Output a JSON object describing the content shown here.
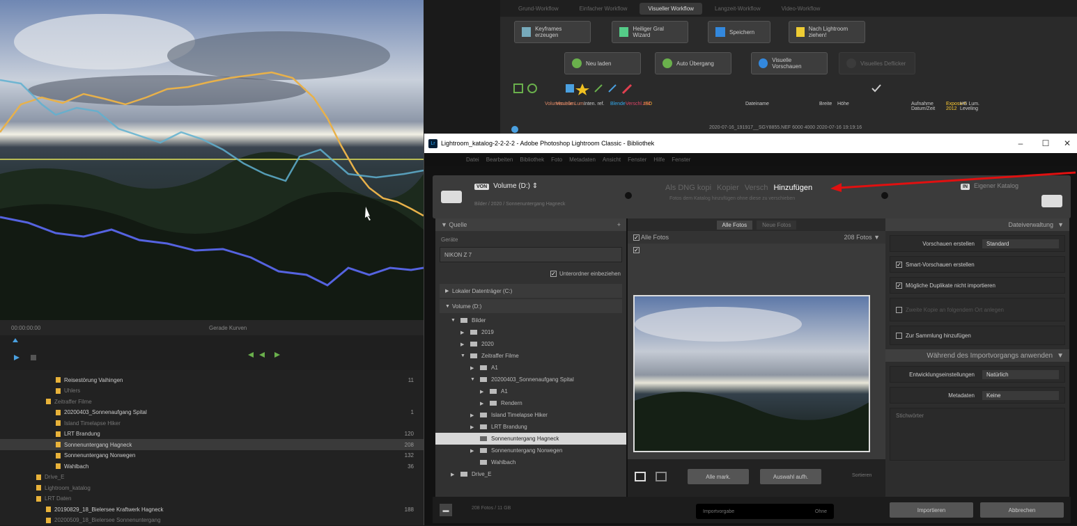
{
  "left_panel": {
    "timecode": "00:00:00:00",
    "status": "Gerade Kurven",
    "tree": [
      {
        "label": "Reisestörung Vaihingen",
        "count": "11",
        "dim": false,
        "sel": false,
        "indent": 80
      },
      {
        "label": "Uhlers",
        "count": "",
        "dim": true,
        "sel": false,
        "indent": 80
      },
      {
        "label": "Zeitraffer Filme",
        "count": "",
        "dim": true,
        "sel": false,
        "indent": 66
      },
      {
        "label": "20200403_Sonnenaufgang Spital",
        "count": "1",
        "dim": false,
        "sel": false,
        "indent": 80
      },
      {
        "label": "Island Timelapse Hiker",
        "count": "",
        "dim": true,
        "sel": false,
        "indent": 80
      },
      {
        "label": "LRT Brandung",
        "count": "120",
        "dim": false,
        "sel": false,
        "indent": 80
      },
      {
        "label": "Sonnenuntergang Hagneck",
        "count": "208",
        "dim": false,
        "sel": true,
        "indent": 80
      },
      {
        "label": "Sonnenuntergang Norwegen",
        "count": "132",
        "dim": false,
        "sel": false,
        "indent": 80
      },
      {
        "label": "Wahlbach",
        "count": "36",
        "dim": false,
        "sel": false,
        "indent": 80
      },
      {
        "label": "Drive_E",
        "count": "",
        "dim": true,
        "sel": false,
        "indent": 52
      },
      {
        "label": "Lightroom_katalog",
        "count": "",
        "dim": true,
        "sel": false,
        "indent": 52
      },
      {
        "label": "LRT Daten",
        "count": "",
        "dim": true,
        "sel": false,
        "indent": 52
      },
      {
        "label": "20190829_18_Bielersee Kraftwerk Hagneck",
        "count": "188",
        "dim": false,
        "sel": false,
        "indent": 66
      },
      {
        "label": "20200509_18_Bielersee Sonnenuntergang",
        "count": "",
        "dim": true,
        "sel": false,
        "indent": 66
      }
    ]
  },
  "top_right": {
    "tabs": [
      "Grund-Workflow",
      "Einfacher Workflow",
      "Visueller Workflow",
      "Langzeit-Workflow",
      "Video-Workflow"
    ],
    "active_tab": 2,
    "row1": [
      "Keyframes erzeugen",
      "Heiliger Gral Wizard",
      "Speichern",
      "Nach Lightroom ziehen!"
    ],
    "row2": [
      "Neu laden",
      "Auto Übergang",
      "Visuelle Vorschauen",
      "Visuelles Deflicker"
    ],
    "headers": [
      "Volumen Lum.",
      "Visuelle Lum.",
      "Inten. ref.",
      "Blende",
      "Verschl.zeit",
      "ISO",
      "Dateiname",
      "Breite",
      "Höhe",
      "Aufnahme Datum/Zeit",
      "Exposure 2012",
      "HG Lum. Leveling"
    ],
    "row_values": "2020-07-16_191917__SGY8855.NEF   6000   4000   2020-07-16 19:19:16"
  },
  "dialog": {
    "title": "Lightroom_katalog-2-2-2-2 - Adobe Photoshop Lightroom Classic - Bibliothek",
    "menu": [
      "Datei",
      "Bearbeiten",
      "Bibliothek",
      "Foto",
      "Metadaten",
      "Ansicht",
      "Fenster",
      "Hilfe",
      "Fenster"
    ],
    "from_badge": "VON",
    "from_label": "Volume (D:)",
    "from_path": "Bilder / 2020 / Sonnenuntergang Hagneck",
    "modes": [
      "Als DNG kopi",
      "Kopier",
      "Versch",
      "Hinzufügen"
    ],
    "modes_sub": "Fotos dem Katalog hinzufügen ohne diese zu verschieben",
    "to_badge": "IN",
    "to_label": "Eigener Katalog",
    "source_header": "Quelle",
    "source_label": "Geräte",
    "device": "NIKON Z 7",
    "device_option": "Unterordner einbeziehen",
    "tree": [
      {
        "label": "Lokaler Datenträger (C:)",
        "level": 0,
        "arrow": "▶",
        "folder": false
      },
      {
        "label": "Volume (D:)",
        "level": 0,
        "arrow": "▼",
        "folder": false
      },
      {
        "label": "Bilder",
        "level": 1,
        "arrow": "▼",
        "folder": true
      },
      {
        "label": "2019",
        "level": 2,
        "arrow": "▶",
        "folder": true
      },
      {
        "label": "2020",
        "level": 2,
        "arrow": "▶",
        "folder": true
      },
      {
        "label": "Zeitraffer Filme",
        "level": 2,
        "arrow": "▼",
        "folder": true
      },
      {
        "label": "A1",
        "level": 3,
        "arrow": "▶",
        "folder": true
      },
      {
        "label": "20200403_Sonnenaufgang Spital",
        "level": 3,
        "arrow": "▼",
        "folder": true
      },
      {
        "label": "A1",
        "level": 4,
        "arrow": "▶",
        "folder": true
      },
      {
        "label": "Rendern",
        "level": 4,
        "arrow": "▶",
        "folder": true
      },
      {
        "label": "Island Timelapse Hiker",
        "level": 3,
        "arrow": "▶",
        "folder": true
      },
      {
        "label": "LRT Brandung",
        "level": 3,
        "arrow": "▶",
        "folder": true
      },
      {
        "label": "Sonnenuntergang Hagneck",
        "level": 3,
        "arrow": "",
        "folder": true,
        "sel": true
      },
      {
        "label": "Sonnenuntergang Norwegen",
        "level": 3,
        "arrow": "▶",
        "folder": true
      },
      {
        "label": "Wahlbach",
        "level": 3,
        "arrow": "",
        "folder": true
      },
      {
        "label": "Drive_E",
        "level": 1,
        "arrow": "▶",
        "folder": true
      }
    ],
    "grid_tabs": [
      "Alle Fotos",
      "Neue Fotos"
    ],
    "grid_all": "Alle Fotos",
    "grid_count": "208 Fotos",
    "btn_check_all": "Alle mark.",
    "btn_uncheck_all": "Auswahl aufh.",
    "sort": "Sortieren",
    "file_header": "Dateiverwaltung",
    "previews_label": "Vorschauen erstellen",
    "previews_value": "Standard",
    "smart_previews": "Smart-Vorschauen erstellen",
    "no_duplicates": "Mögliche Duplikate nicht importieren",
    "second_copy": "Zweite Kopie an folgendem Ort anlegen",
    "collection": "Zur Sammlung hinzufügen",
    "apply_header": "Während des Importvorgangs anwenden",
    "dev_label": "Entwicklungseinstellungen",
    "dev_value": "Natürlich",
    "meta_label": "Metadaten",
    "meta_value": "Keine",
    "keywords_label": "Stichwörter",
    "footer_count": "208 Fotos / 11 GB",
    "preset_label": "Importvorgabe",
    "preset_value": "Ohne",
    "btn_import": "Importieren",
    "btn_cancel": "Abbrechen"
  }
}
